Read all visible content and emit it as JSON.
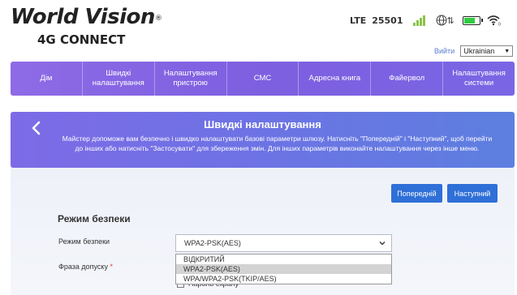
{
  "header": {
    "brand_main": "World Vision",
    "brand_reg": "®",
    "brand_sub": "4G CONNECT",
    "network_type": "LTE",
    "network_code": "25501",
    "logout": "Вийти",
    "language": "Ukrainian",
    "icons": [
      "signal-icon",
      "globe-icon",
      "data-transfer-icon",
      "battery-icon",
      "wifi-icon"
    ],
    "signal_bars": 4,
    "battery_level": 0.8,
    "wifi_clients": "0"
  },
  "nav": {
    "items": [
      "Дім",
      "Швидкі налаштування",
      "Налаштування пристрою",
      "СМС",
      "Адресна книга",
      "Файервол",
      "Налаштування системи"
    ]
  },
  "wizard": {
    "title": "Швидкі налаштування",
    "description": "Майстер допоможе вам безпечно і швидко налаштувати базові параметри шлюзу. Натисніть \"Попередній\" і \"Наступний\", щоб перейти до інших або натисніть \"Застосувати\" для збереження змін. Для інших параметрів виконайте налаштування через інше меню.",
    "prev_label": "Попередній",
    "next_label": "Наступний"
  },
  "form": {
    "section_title": "Режим безпеки",
    "mode_label": "Режим безпеки",
    "mode_value": "WPA2-PSK(AES)",
    "passphrase_label": "Фраза допуску",
    "required_mark": "*",
    "show_password_label": "Пароль екрану",
    "options": [
      "ВІДКРИТИЙ",
      "WPA2-PSK(AES)",
      "WPA/WPA2-PSK(TKIP/AES)"
    ],
    "selected_option": 1
  },
  "colors": {
    "nav_gradient_start": "#8e6be6",
    "banner_gradient_end": "#5d7fe0",
    "button_blue": "#2f6fd8",
    "signal_green": "#8bc34a",
    "battery_green": "#2ecc40",
    "required_red": "#e53935"
  }
}
